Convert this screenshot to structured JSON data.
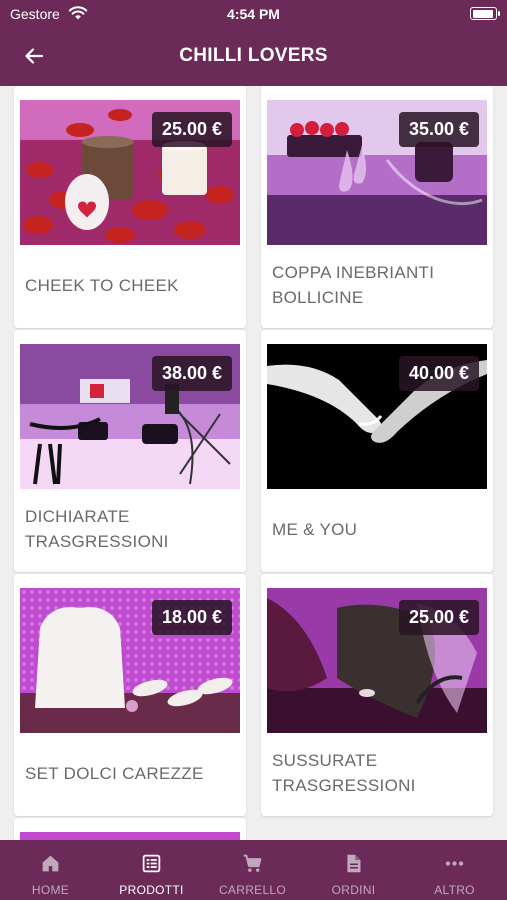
{
  "status_bar": {
    "carrier": "Gestore",
    "time": "4:54 PM"
  },
  "header": {
    "title": "CHILLI LOVERS"
  },
  "products": [
    {
      "name": "CHEEK TO CHEEK",
      "price": "25.00 €"
    },
    {
      "name": "COPPA INEBRIANTI BOLLICINE",
      "price": "35.00 €"
    },
    {
      "name": "DICHIARATE TRASGRESSIONI",
      "price": "38.00 €"
    },
    {
      "name": "ME & YOU",
      "price": "40.00 €"
    },
    {
      "name": "SET DOLCI CAREZZE",
      "price": "18.00 €"
    },
    {
      "name": "SUSSURATE TRASGRESSIONI",
      "price": "25.00 €"
    }
  ],
  "tabs": [
    {
      "label": "HOME",
      "icon": "home-icon"
    },
    {
      "label": "PRODOTTI",
      "icon": "list-icon"
    },
    {
      "label": "CARRELLO",
      "icon": "cart-icon"
    },
    {
      "label": "ORDINI",
      "icon": "document-icon"
    },
    {
      "label": "ALTRO",
      "icon": "more-icon"
    }
  ],
  "active_tab": "PRODOTTI",
  "colors": {
    "brand": "#6b2a58",
    "tab_inactive": "#c1a8bb",
    "background": "#efefef"
  }
}
